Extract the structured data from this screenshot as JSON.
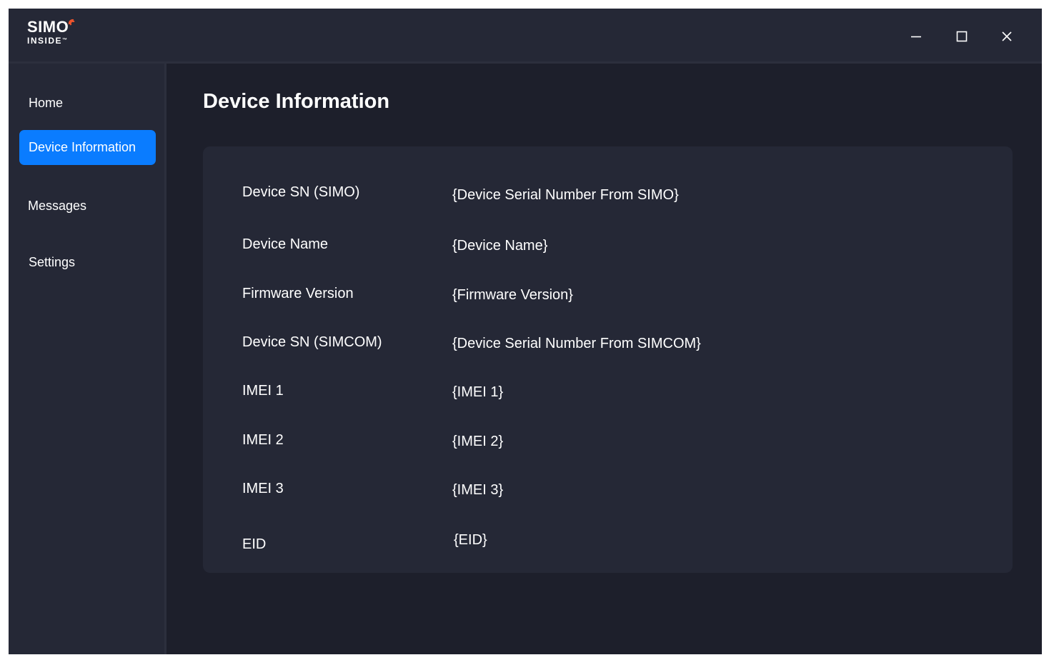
{
  "titlebar": {
    "logo_top": "SIMO",
    "logo_bottom": "INSIDE",
    "logo_tm": "™",
    "icons": [
      "minimize-icon",
      "maximize-icon",
      "close-icon"
    ]
  },
  "sidebar": {
    "items": [
      {
        "label": "Home",
        "active": false
      },
      {
        "label": "Device Information",
        "active": true
      },
      {
        "label": "Messages",
        "active": false
      },
      {
        "label": "Settings",
        "active": false
      }
    ]
  },
  "main": {
    "title": "Device Information",
    "rows": [
      {
        "label": "Device SN (SIMO)",
        "value": "{Device Serial Number From SIMO}"
      },
      {
        "label": "Device Name",
        "value": "{Device Name}"
      },
      {
        "label": "Firmware Version",
        "value": "{Firmware Version}"
      },
      {
        "label": "Device SN (SIMCOM)",
        "value": "{Device Serial Number From SIMCOM}"
      },
      {
        "label": "IMEI 1",
        "value": "{IMEI 1}"
      },
      {
        "label": "IMEI 2",
        "value": "{IMEI 2}"
      },
      {
        "label": "IMEI 3",
        "value": "{IMEI 3}"
      },
      {
        "label": "EID",
        "value": "{EID}"
      }
    ]
  },
  "colors": {
    "background": "#1d1f2b",
    "panel": "#252836",
    "accent": "#0a7cff",
    "logo_accent": "#f2552c",
    "text": "#ffffff"
  }
}
